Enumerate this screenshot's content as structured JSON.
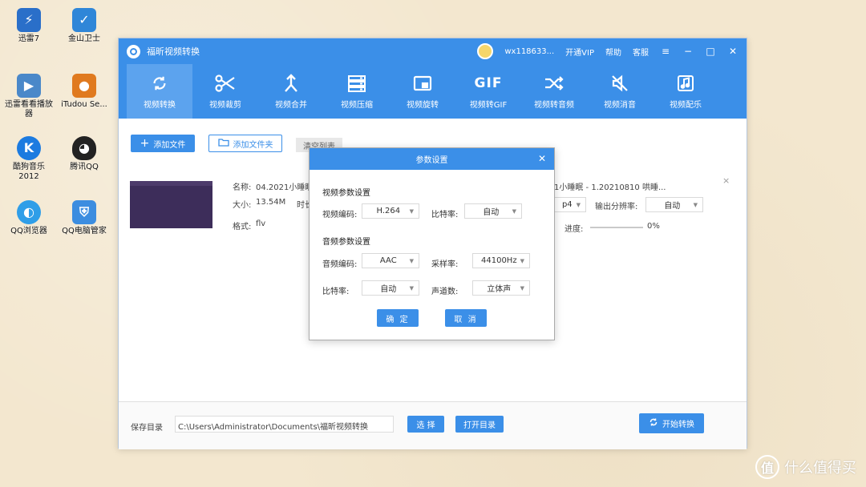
{
  "desktop": {
    "icons": [
      {
        "label": "迅雷7",
        "icon": "xunlei-icon",
        "color": "#2a6fc9"
      },
      {
        "label": "金山卫士",
        "icon": "jinshan-shield-icon",
        "color": "#2f86d8"
      },
      {
        "label": "迅雷看看播放器",
        "icon": "xunlei-player-icon",
        "color": "#4a88c9"
      },
      {
        "label": "iTudou Se...",
        "icon": "tudou-icon",
        "color": "#e07a1f"
      },
      {
        "label": "酷狗音乐2012",
        "icon": "kugou-icon",
        "color": "#1c7be0"
      },
      {
        "label": "腾讯QQ",
        "icon": "qq-penguin-icon",
        "color": "#222222"
      },
      {
        "label": "QQ浏览器",
        "icon": "qq-browser-icon",
        "color": "#2f9ee8"
      },
      {
        "label": "QQ电脑管家",
        "icon": "qq-guanjia-icon",
        "color": "#3c8de0"
      }
    ]
  },
  "window": {
    "title": "福昕视频转换",
    "username": "wx118633...",
    "vip": "开通VIP",
    "help": "帮助",
    "service": "客服",
    "colors": {
      "accent": "#3b8fe8",
      "active_tab": "#5ca3ee"
    }
  },
  "toolbar": {
    "items": [
      {
        "label": "视频转换",
        "icon": "convert-icon"
      },
      {
        "label": "视频裁剪",
        "icon": "scissors-icon"
      },
      {
        "label": "视频合并",
        "icon": "merge-icon"
      },
      {
        "label": "视频压缩",
        "icon": "compress-icon"
      },
      {
        "label": "视频旋转",
        "icon": "rotate-icon"
      },
      {
        "label": "视频转GIF",
        "icon": "gif-icon"
      },
      {
        "label": "视频转音频",
        "icon": "shuffle-icon"
      },
      {
        "label": "视频消音",
        "icon": "mute-icon"
      },
      {
        "label": "视频配乐",
        "icon": "music-note-icon"
      }
    ]
  },
  "actions": {
    "add_file": "添加文件",
    "add_folder": "添加文件夹",
    "clear_list": "清空列表"
  },
  "file": {
    "name_label": "名称:",
    "name_value": "04.2021小睡眠",
    "size_label": "大小:",
    "size_value": "13.54M",
    "time_label": "时长",
    "format_label": "格式:",
    "format_value": "flv",
    "output_name": "1小睡眠 - 1.20210810 哄睡...",
    "output_format": "p4",
    "resolution_label": "输出分辨率:",
    "resolution_value": "自动",
    "progress_label": "进度:",
    "progress_value": "0%",
    "progress": 0
  },
  "bottom": {
    "save_label": "保存目录",
    "save_path": "C:\\Users\\Administrator\\Documents\\福昕视频转换",
    "choose": "选 择",
    "open_dir": "打开目录",
    "start": "开始转换"
  },
  "dialog": {
    "title": "参数设置",
    "video_section": "视频参数设置",
    "video_codec_label": "视频编码:",
    "video_codec": "H.264",
    "video_bitrate_label": "比特率:",
    "video_bitrate": "自动",
    "audio_section": "音频参数设置",
    "audio_codec_label": "音频编码:",
    "audio_codec": "AAC",
    "sample_rate_label": "采样率:",
    "sample_rate": "44100Hz",
    "audio_bitrate_label": "比特率:",
    "audio_bitrate": "自动",
    "channels_label": "声道数:",
    "channels": "立体声",
    "ok": "确 定",
    "cancel": "取 消"
  },
  "watermark": {
    "text": "什么值得买",
    "glyph": "值"
  }
}
